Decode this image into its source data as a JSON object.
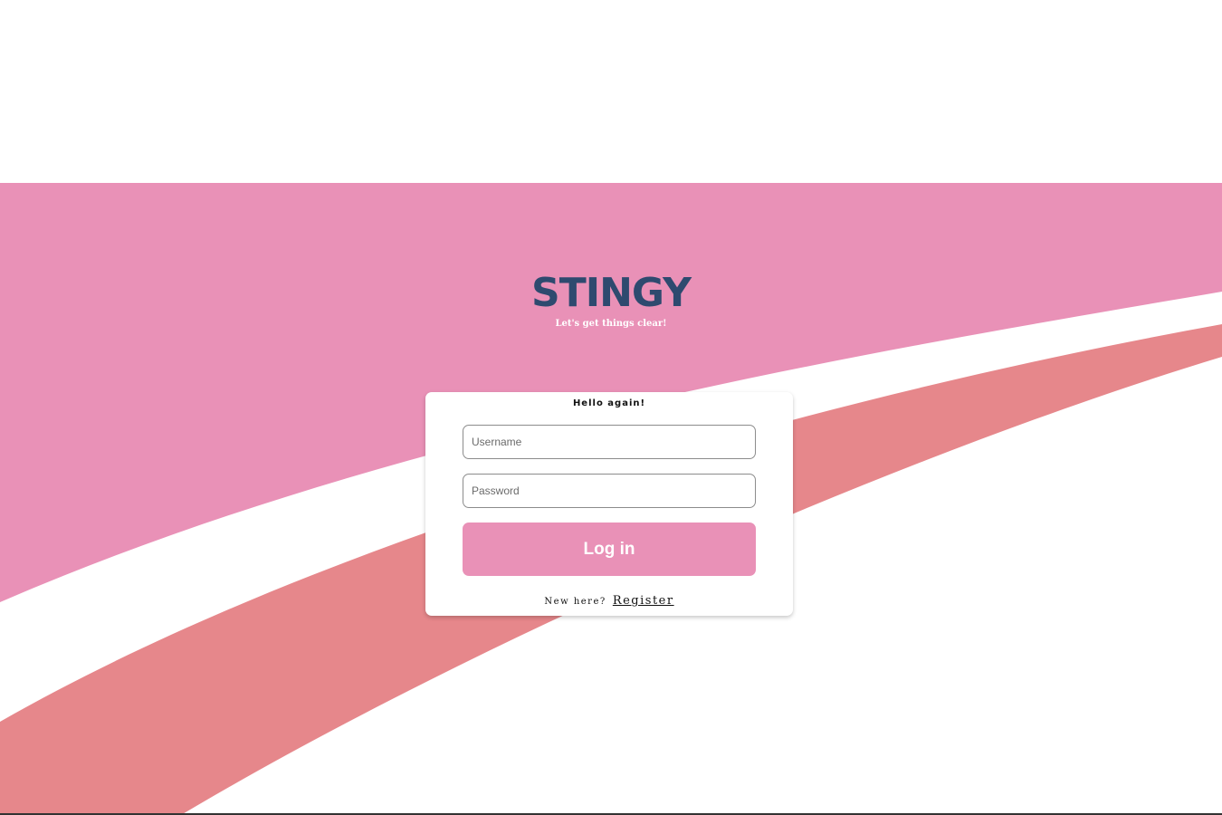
{
  "brand": {
    "name": "STINGY",
    "tagline": "Let's get things clear!"
  },
  "login": {
    "title": "Hello again!",
    "username_placeholder": "Username",
    "password_placeholder": "Password",
    "submit_label": "Log in",
    "register_prompt": "New here?",
    "register_link": "Register"
  },
  "colors": {
    "brand_pink": "#e991b7",
    "accent_coral": "#e6878b",
    "logo_navy": "#2e4a6f",
    "background": "#ffffff"
  }
}
